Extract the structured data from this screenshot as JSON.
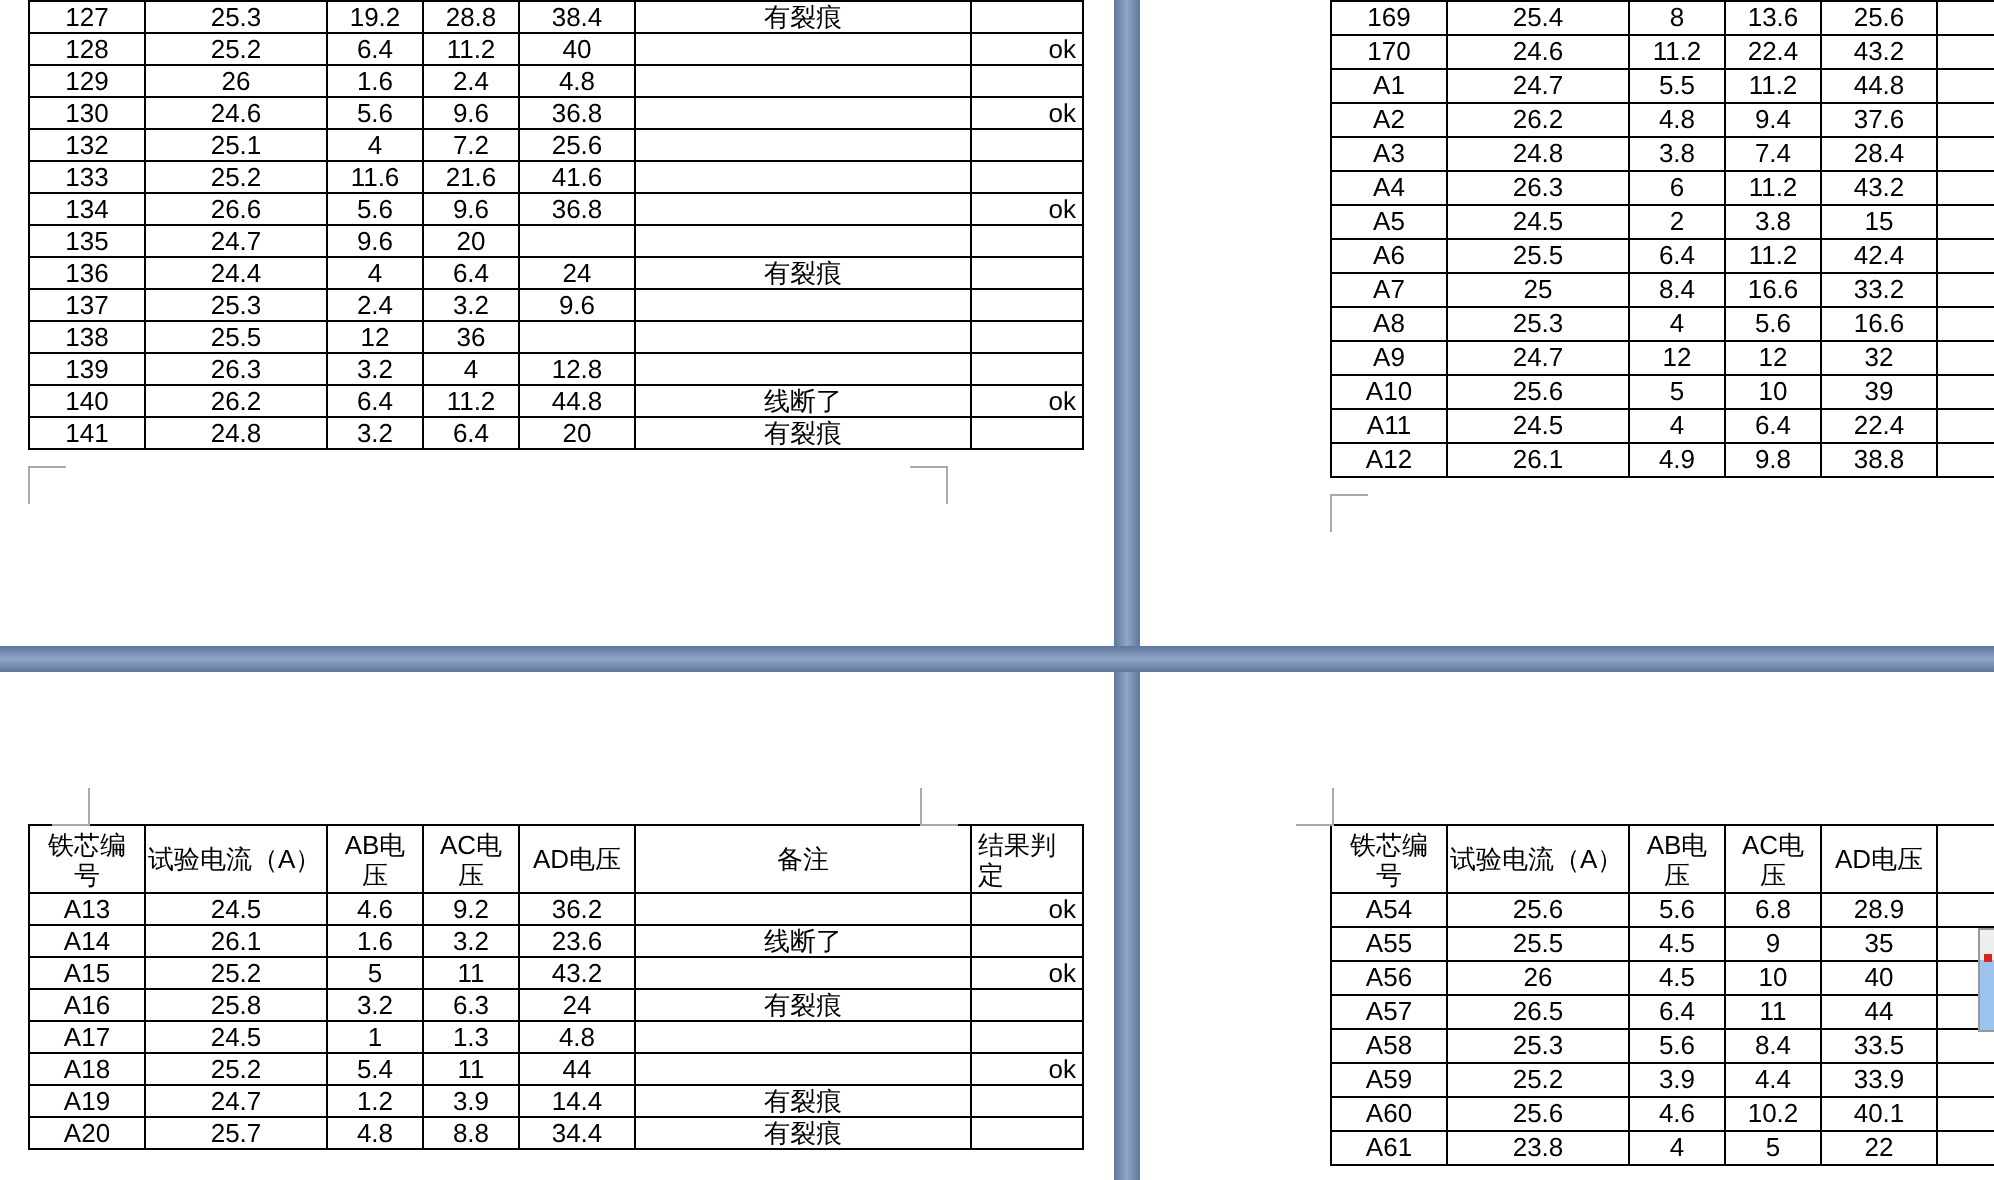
{
  "pages": [
    {
      "kind": "full",
      "rows": [
        {
          "id": "127",
          "current": "25.3",
          "ab": "19.2",
          "ac": "28.8",
          "ad": "38.4",
          "note": "有裂痕"
        },
        {
          "id": "128",
          "current": "25.2",
          "ab": "6.4",
          "ac": "11.2",
          "ad": "40",
          "result": "ok"
        },
        {
          "id": "129",
          "current": "26",
          "ab": "1.6",
          "ac": "2.4",
          "ad": "4.8"
        },
        {
          "id": "130",
          "current": "24.6",
          "ab": "5.6",
          "ac": "9.6",
          "ad": "36.8",
          "result": "ok"
        },
        {
          "id": "132",
          "current": "25.1",
          "ab": "4",
          "ac": "7.2",
          "ad": "25.6"
        },
        {
          "id": "133",
          "current": "25.2",
          "ab": "11.6",
          "ac": "21.6",
          "ad": "41.6"
        },
        {
          "id": "134",
          "current": "26.6",
          "ab": "5.6",
          "ac": "9.6",
          "ad": "36.8",
          "result": "ok"
        },
        {
          "id": "135",
          "current": "24.7",
          "ab": "9.6",
          "ac": "20"
        },
        {
          "id": "136",
          "current": "24.4",
          "ab": "4",
          "ac": "6.4",
          "ad": "24",
          "note": "有裂痕"
        },
        {
          "id": "137",
          "current": "25.3",
          "ab": "2.4",
          "ac": "3.2",
          "ad": "9.6"
        },
        {
          "id": "138",
          "current": "25.5",
          "ab": "12",
          "ac": "36"
        },
        {
          "id": "139",
          "current": "26.3",
          "ab": "3.2",
          "ac": "4",
          "ad": "12.8"
        },
        {
          "id": "140",
          "current": "26.2",
          "ab": "6.4",
          "ac": "11.2",
          "ad": "44.8",
          "note": "线断了",
          "result": "ok"
        },
        {
          "id": "141",
          "current": "24.8",
          "ab": "3.2",
          "ac": "6.4",
          "ad": "20",
          "note": "有裂痕"
        }
      ]
    },
    {
      "kind": "cut",
      "rows": [
        {
          "id": "169",
          "current": "25.4",
          "ab": "8",
          "ac": "13.6",
          "ad": "25.6"
        },
        {
          "id": "170",
          "current": "24.6",
          "ab": "11.2",
          "ac": "22.4",
          "ad": "43.2"
        },
        {
          "id": "A1",
          "current": "24.7",
          "ab": "5.5",
          "ac": "11.2",
          "ad": "44.8"
        },
        {
          "id": "A2",
          "current": "26.2",
          "ab": "4.8",
          "ac": "9.4",
          "ad": "37.6"
        },
        {
          "id": "A3",
          "current": "24.8",
          "ab": "3.8",
          "ac": "7.4",
          "ad": "28.4"
        },
        {
          "id": "A4",
          "current": "26.3",
          "ab": "6",
          "ac": "11.2",
          "ad": "43.2"
        },
        {
          "id": "A5",
          "current": "24.5",
          "ab": "2",
          "ac": "3.8",
          "ad": "15"
        },
        {
          "id": "A6",
          "current": "25.5",
          "ab": "6.4",
          "ac": "11.2",
          "ad": "42.4"
        },
        {
          "id": "A7",
          "current": "25",
          "ab": "8.4",
          "ac": "16.6",
          "ad": "33.2"
        },
        {
          "id": "A8",
          "current": "25.3",
          "ab": "4",
          "ac": "5.6",
          "ad": "16.6"
        },
        {
          "id": "A9",
          "current": "24.7",
          "ab": "12",
          "ac": "12",
          "ad": "32"
        },
        {
          "id": "A10",
          "current": "25.6",
          "ab": "5",
          "ac": "10",
          "ad": "39"
        },
        {
          "id": "A11",
          "current": "24.5",
          "ab": "4",
          "ac": "6.4",
          "ad": "22.4"
        },
        {
          "id": "A12",
          "current": "26.1",
          "ab": "4.9",
          "ac": "9.8",
          "ad": "38.8"
        }
      ]
    },
    {
      "kind": "full",
      "columns": [
        "铁芯编号",
        "试验电流（A）",
        "AB电压",
        "AC电压",
        "AD电压",
        "备注",
        "结果判定"
      ],
      "rows": [
        {
          "id": "A13",
          "current": "24.5",
          "ab": "4.6",
          "ac": "9.2",
          "ad": "36.2",
          "result": "ok"
        },
        {
          "id": "A14",
          "current": "26.1",
          "ab": "1.6",
          "ac": "3.2",
          "ad": "23.6",
          "note": "线断了"
        },
        {
          "id": "A15",
          "current": "25.2",
          "ab": "5",
          "ac": "11",
          "ad": "43.2",
          "result": "ok"
        },
        {
          "id": "A16",
          "current": "25.8",
          "ab": "3.2",
          "ac": "6.3",
          "ad": "24",
          "note": "有裂痕"
        },
        {
          "id": "A17",
          "current": "24.5",
          "ab": "1",
          "ac": "1.3",
          "ad": "4.8"
        },
        {
          "id": "A18",
          "current": "25.2",
          "ab": "5.4",
          "ac": "11",
          "ad": "44",
          "result": "ok"
        },
        {
          "id": "A19",
          "current": "24.7",
          "ab": "1.2",
          "ac": "3.9",
          "ad": "14.4",
          "note": "有裂痕"
        },
        {
          "id": "A20",
          "current": "25.7",
          "ab": "4.8",
          "ac": "8.8",
          "ad": "34.4",
          "note": "有裂痕"
        }
      ]
    },
    {
      "kind": "cut",
      "columns": [
        "铁芯编号",
        "试验电流（A）",
        "AB电压",
        "AC电压",
        "AD电压"
      ],
      "rows": [
        {
          "id": "A54",
          "current": "25.6",
          "ab": "5.6",
          "ac": "6.8",
          "ad": "28.9"
        },
        {
          "id": "A55",
          "current": "25.5",
          "ab": "4.5",
          "ac": "9",
          "ad": "35"
        },
        {
          "id": "A56",
          "current": "26",
          "ab": "4.5",
          "ac": "10",
          "ad": "40"
        },
        {
          "id": "A57",
          "current": "26.5",
          "ab": "6.4",
          "ac": "11",
          "ad": "44"
        },
        {
          "id": "A58",
          "current": "25.3",
          "ab": "5.6",
          "ac": "8.4",
          "ad": "33.5"
        },
        {
          "id": "A59",
          "current": "25.2",
          "ab": "3.9",
          "ac": "4.4",
          "ad": "33.9"
        },
        {
          "id": "A60",
          "current": "25.6",
          "ab": "4.6",
          "ac": "10.2",
          "ad": "40.1"
        },
        {
          "id": "A61",
          "current": "23.8",
          "ab": "4",
          "ac": "5",
          "ad": "22"
        }
      ]
    }
  ]
}
